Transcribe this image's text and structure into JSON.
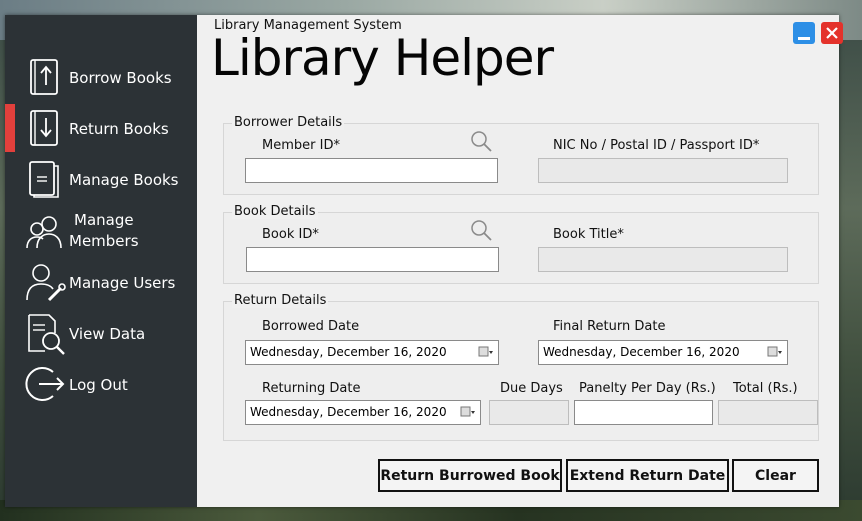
{
  "sidebar": {
    "items": [
      {
        "label": "Borrow Books",
        "icon": "borrow-book-icon"
      },
      {
        "label": "Return Books",
        "icon": "return-book-icon",
        "active": true
      },
      {
        "label": "Manage Books",
        "icon": "manage-books-icon"
      },
      {
        "label": "Manage\nMembers",
        "line1": "Manage",
        "line2": "Members",
        "icon": "members-icon"
      },
      {
        "label": "Manage Users",
        "icon": "user-settings-icon"
      },
      {
        "label": "View Data",
        "icon": "view-data-icon"
      },
      {
        "label": "Log Out",
        "icon": "logout-icon"
      }
    ],
    "active_color": "#e2403c"
  },
  "header": {
    "system_name": "Library  Management System",
    "app_title": "Library Helper"
  },
  "borrower": {
    "title": "Borrower Details",
    "member_id_label": "Member ID*",
    "member_id_value": "",
    "nic_label": "NIC No / Postal ID / Passport ID*",
    "nic_value": ""
  },
  "book": {
    "title": "Book Details",
    "book_id_label": "Book ID*",
    "book_id_value": "",
    "book_title_label": "Book Title*",
    "book_title_value": ""
  },
  "return_details": {
    "title": "Return Details",
    "borrowed_date_label": "Borrowed Date",
    "borrowed_date_value": "Wednesday,  December  16, 2020",
    "final_return_label": "Final Return Date",
    "final_return_value": "Wednesday,  December  16, 2020",
    "returning_date_label": "Returning Date",
    "returning_date_value": "Wednesday,  December  16, 2020",
    "due_days_label": "Due Days",
    "due_days_value": "",
    "penalty_label": "Panelty Per Day (Rs.)",
    "penalty_value": "",
    "total_label": "Total (Rs.)",
    "total_value": ""
  },
  "actions": {
    "return_label": "Return Burrowed Book",
    "extend_label": "Extend Return Date",
    "clear_label": "Clear"
  },
  "colors": {
    "sidebar_bg": "#2c3236",
    "minimize": "#2d8fe6",
    "close": "#e4322b"
  }
}
